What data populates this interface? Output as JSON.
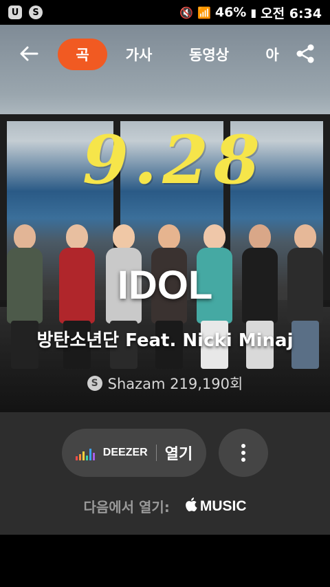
{
  "status_bar": {
    "left_icons": [
      "U",
      "S"
    ],
    "battery": "46%",
    "time": "오전 6:34",
    "glyphs": {
      "mute": "🔇",
      "wifi": "📶",
      "battery": "▮"
    }
  },
  "nav": {
    "tabs": [
      {
        "label": "곡",
        "active": true
      },
      {
        "label": "가사",
        "active": false
      },
      {
        "label": "동영상",
        "active": false
      },
      {
        "label": "아",
        "active": false
      }
    ],
    "accent_color": "#f15a22"
  },
  "hero": {
    "date_text": "9.28",
    "song_title": "IDOL",
    "artist": "방탄소년단 Feat. Nicki Minaj",
    "shazam_count": "Shazam 219,190회"
  },
  "actions": {
    "deezer_brand": "DEEZER",
    "open_label": "열기",
    "also_open_label": "다음에서 열기:",
    "apple_glyph": "",
    "music_label": "MUSIC"
  }
}
